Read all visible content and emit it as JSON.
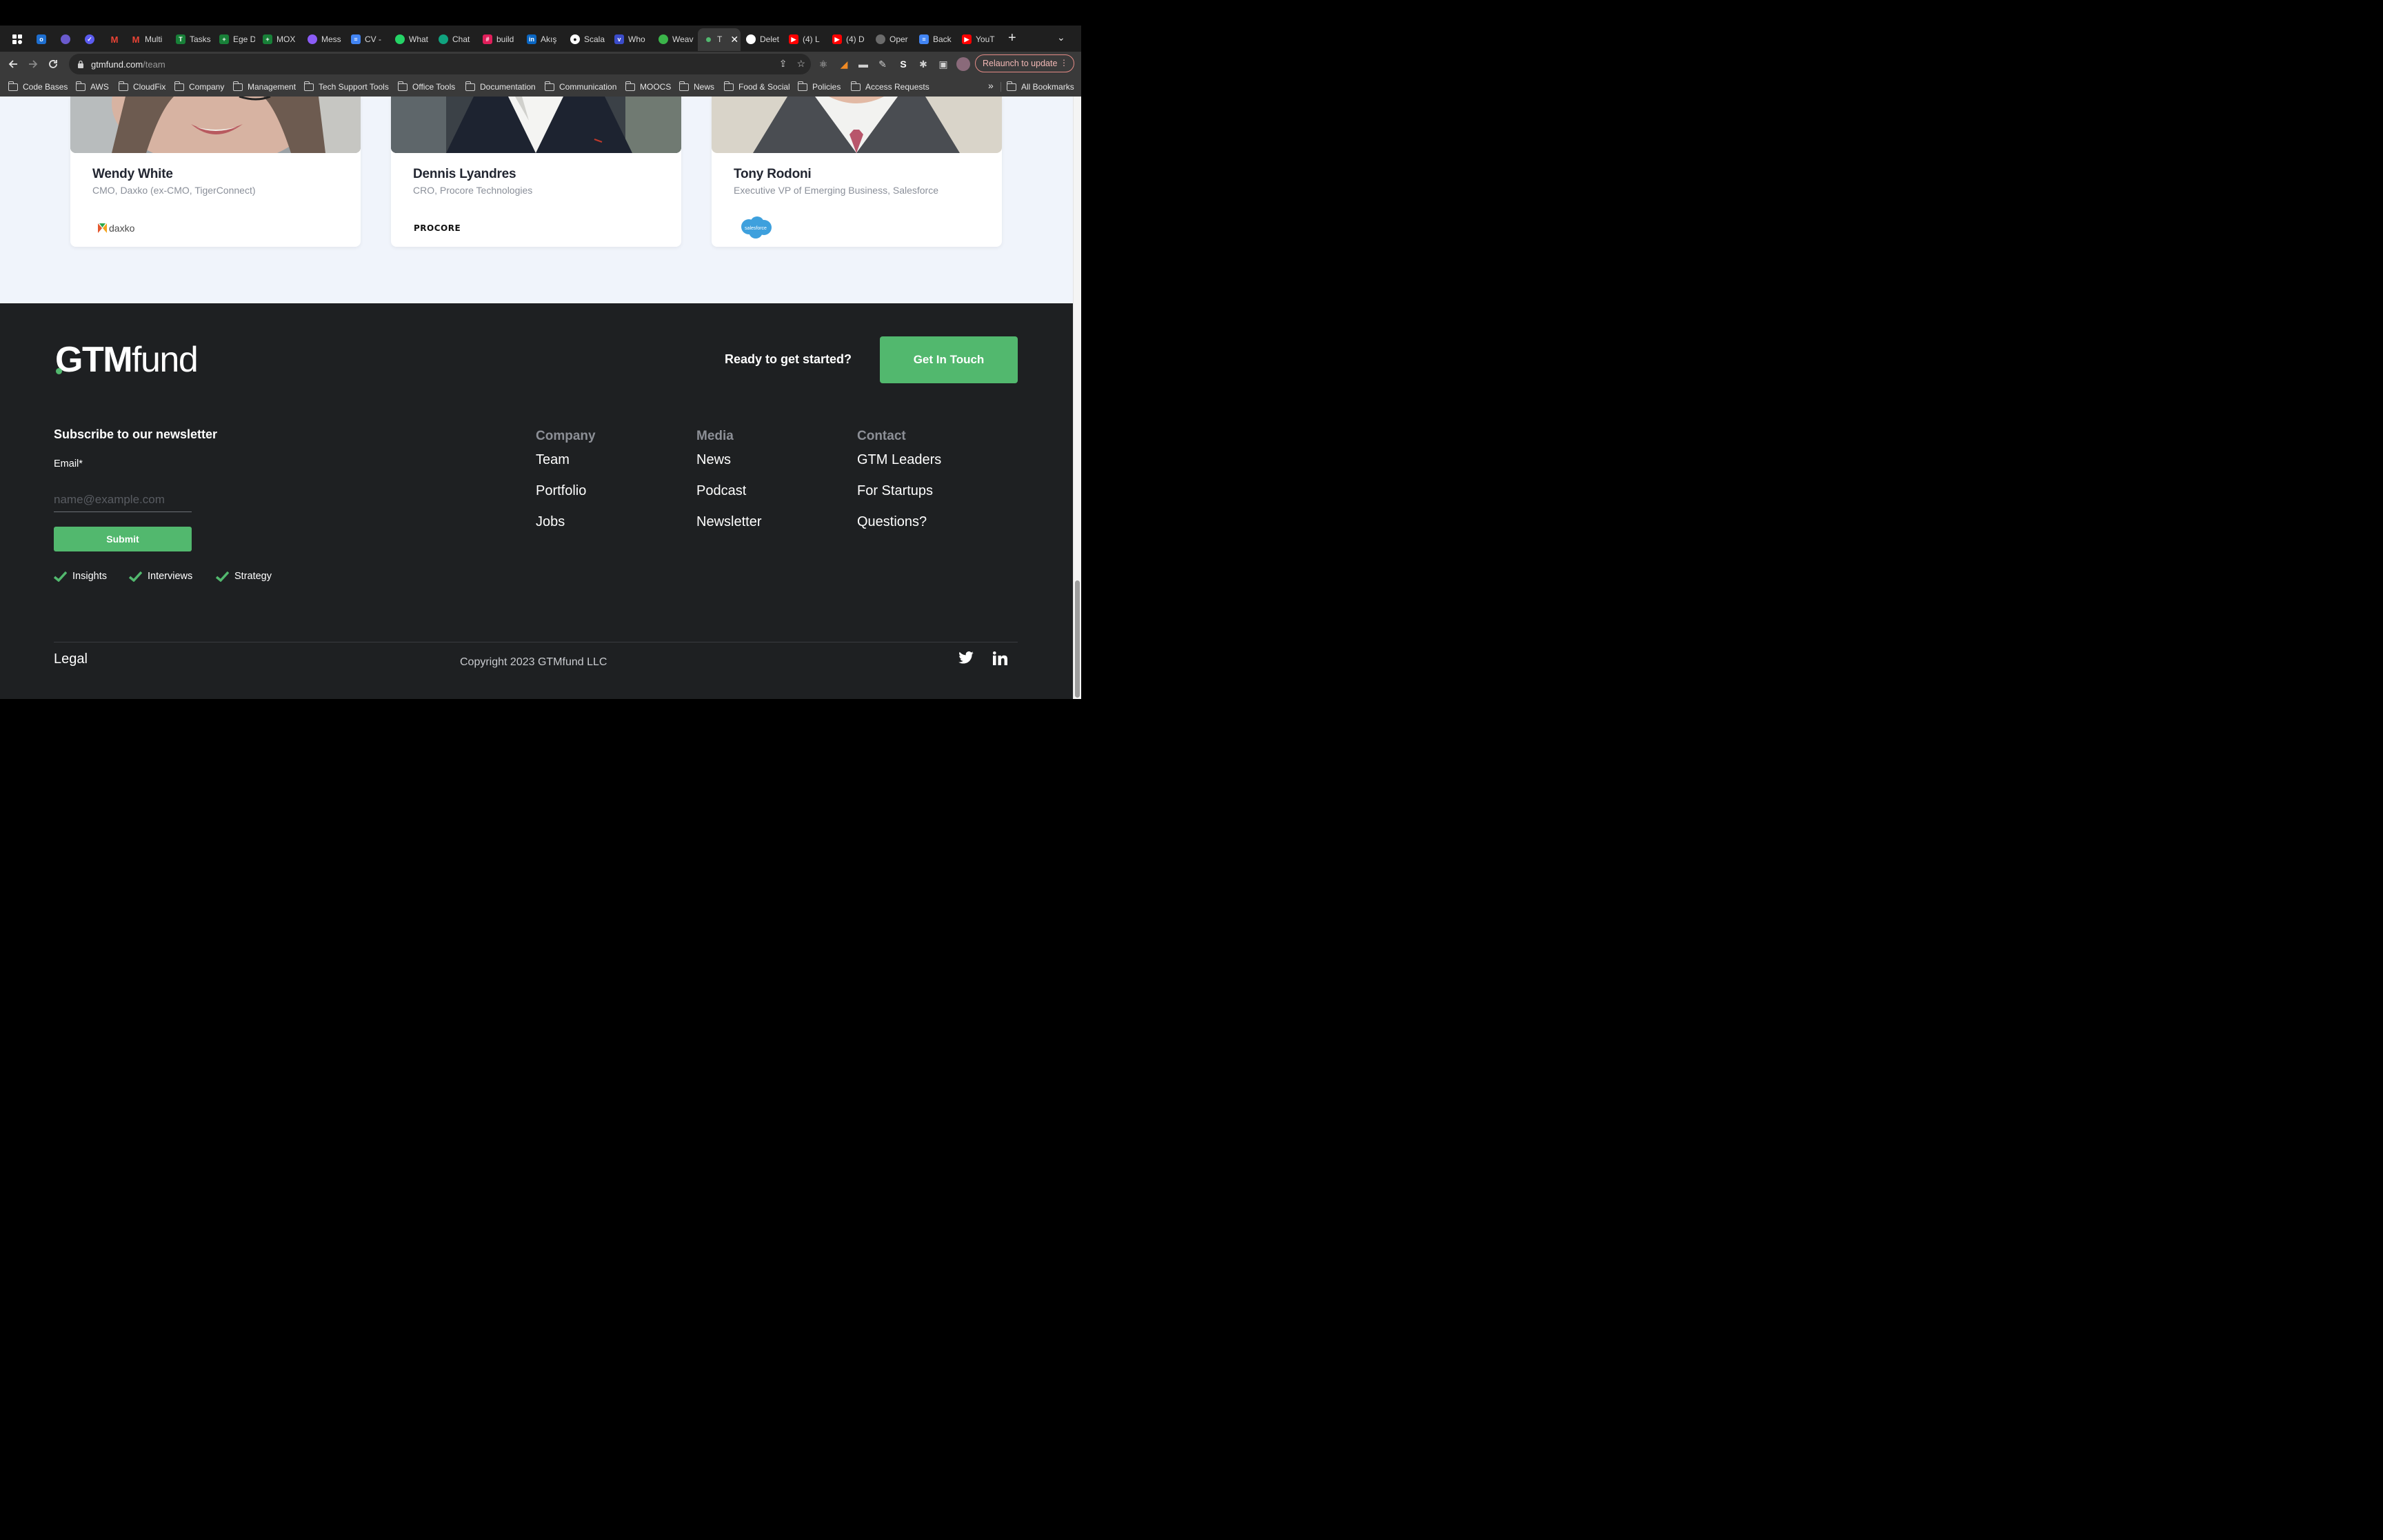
{
  "browser": {
    "tabs": [
      {
        "label": "",
        "icon": "apps-icon",
        "color": "#2f2f2f"
      },
      {
        "label": "",
        "icon": "outlook-icon",
        "color": "#1e6fd0"
      },
      {
        "label": "",
        "icon": "extension-icon",
        "color": "#6a5acd"
      },
      {
        "label": "",
        "icon": "clockify-icon",
        "color": "#5b5bf0"
      },
      {
        "label": "",
        "icon": "gmail-icon",
        "color": "#d93025"
      },
      {
        "label": "Multi",
        "icon": "gmail-icon",
        "color": "#d93025"
      },
      {
        "label": "Tasks",
        "icon": "tasks-icon",
        "color": "#188038"
      },
      {
        "label": "Ege D",
        "icon": "sheets-icon",
        "color": "#188038"
      },
      {
        "label": "MOX",
        "icon": "sheets-icon",
        "color": "#188038"
      },
      {
        "label": "Mess",
        "icon": "messenger-icon",
        "color": "#8b5cf6"
      },
      {
        "label": "CV -",
        "icon": "docs-icon",
        "color": "#4285f4"
      },
      {
        "label": "What",
        "icon": "whatsapp-icon",
        "color": "#25d366"
      },
      {
        "label": "Chat",
        "icon": "chatgpt-icon",
        "color": "#10a37f"
      },
      {
        "label": "build",
        "icon": "slack-icon",
        "color": "#e01e5a"
      },
      {
        "label": "Akış",
        "icon": "linkedin-icon",
        "color": "#0a66c2"
      },
      {
        "label": "Scala",
        "icon": "medium-icon",
        "color": "#111111"
      },
      {
        "label": "Who",
        "icon": "wallet-icon",
        "color": "#3b4cca"
      },
      {
        "label": "Weav",
        "icon": "weaviate-icon",
        "color": "#3bb54a"
      },
      {
        "label": "T",
        "icon": "gtmfund-icon",
        "color": "#52b86e",
        "active": true
      },
      {
        "label": "Delet",
        "icon": "github-icon",
        "color": "#ffffff"
      },
      {
        "label": "(4) L",
        "icon": "youtube-icon",
        "color": "#ff0000"
      },
      {
        "label": "(4) D",
        "icon": "youtube-icon",
        "color": "#ff0000"
      },
      {
        "label": "Oper",
        "icon": "openai-icon",
        "color": "#9a9a9a"
      },
      {
        "label": "Back",
        "icon": "docs-icon",
        "color": "#4285f4"
      },
      {
        "label": "YouT",
        "icon": "youtube-icon",
        "color": "#ff0000"
      }
    ],
    "url_domain": "gtmfund.com",
    "url_path": "/team",
    "relaunch_label": "Relaunch to update",
    "bookmarks": [
      "Code Bases",
      "AWS",
      "CloudFix",
      "Company",
      "Management",
      "Tech Support Tools",
      "Office Tools",
      "Documentation",
      "Communication",
      "MOOCS",
      "News",
      "Food & Social",
      "Policies",
      "Access Requests"
    ],
    "bookmarks_overflow": "»",
    "all_bookmarks": "All Bookmarks"
  },
  "team": [
    {
      "name": "Wendy White",
      "role": "CMO, Daxko (ex-CMO, TigerConnect)",
      "company_logo": "daxko"
    },
    {
      "name": "Dennis Lyandres",
      "role": "CRO, Procore Technologies",
      "company_logo": "PROCORE"
    },
    {
      "name": "Tony Rodoni",
      "role": "Executive VP of Emerging Business, Salesforce",
      "company_logo": "salesforce"
    }
  ],
  "footer": {
    "brand_bold": "GTM",
    "brand_light": "fund",
    "cta_text": "Ready to get started?",
    "cta_button": "Get In Touch",
    "newsletter_title": "Subscribe to our newsletter",
    "email_label": "Email*",
    "email_placeholder": "name@example.com",
    "email_value": "",
    "submit_label": "Submit",
    "checks": [
      "Insights",
      "Interviews",
      "Strategy"
    ],
    "columns": [
      {
        "title": "Company",
        "links": [
          "Team",
          "Portfolio",
          "Jobs"
        ]
      },
      {
        "title": "Media",
        "links": [
          "News",
          "Podcast",
          "Newsletter"
        ]
      },
      {
        "title": "Contact",
        "links": [
          "GTM Leaders",
          "For Startups",
          "Questions?"
        ]
      }
    ],
    "legal": "Legal",
    "copyright": "Copyright 2023 GTMfund LLC",
    "accent_color": "#52b86e"
  }
}
